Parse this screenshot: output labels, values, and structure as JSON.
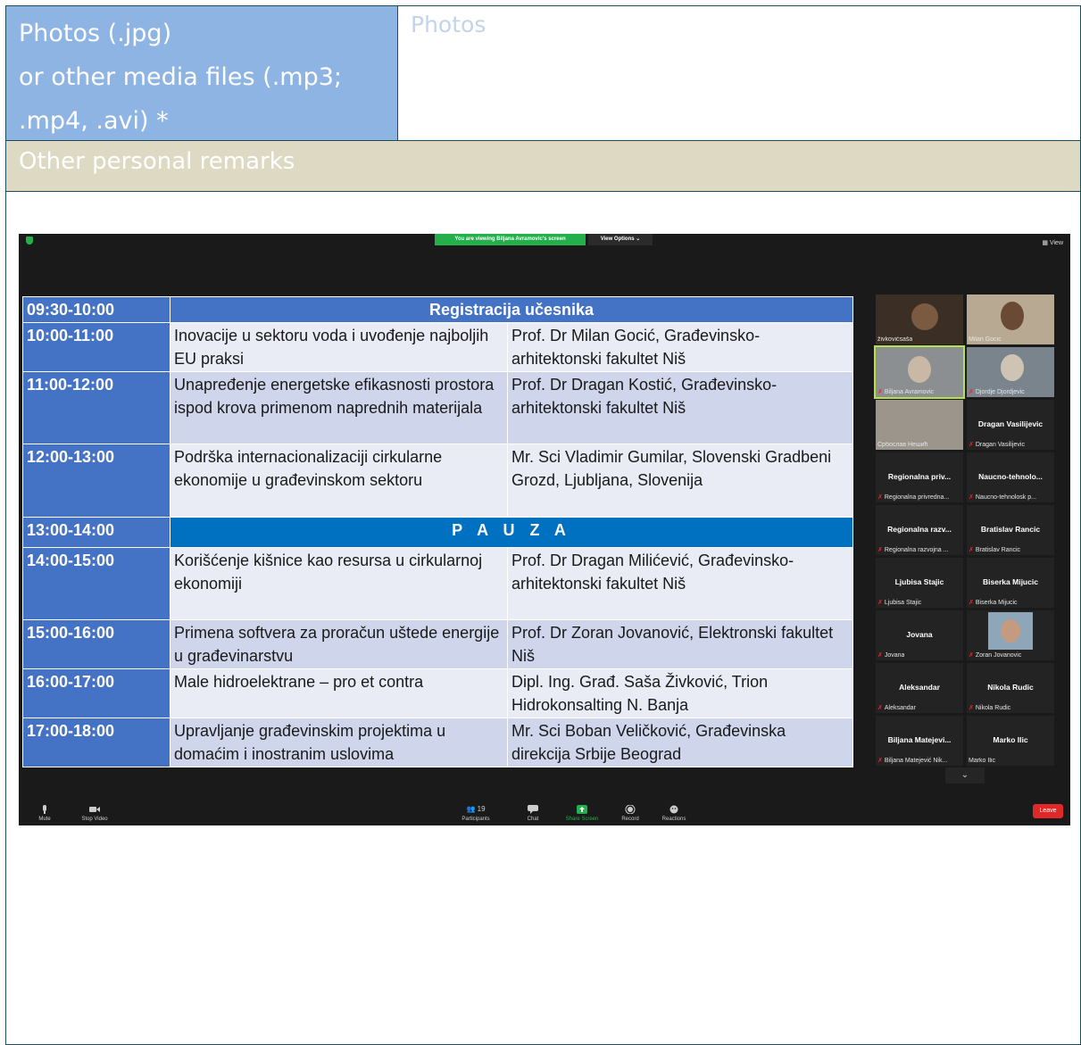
{
  "form": {
    "photos_label_line1": "Photos (.jpg)",
    "photos_label_line2": "or other media files (.mp3;",
    "photos_label_line3": ".mp4, .avi) *",
    "photos_value_placeholder": "Photos",
    "remarks_label": "Other personal remarks"
  },
  "zoom": {
    "viewing_banner": "You are viewing Biljana Avramovic's screen",
    "view_options": "View Options ⌄",
    "view_button": "View",
    "schedule": {
      "header_time": "09:30-10:00",
      "header_title": "Registracija učesnika",
      "pause_time": "13:00-14:00",
      "pause_title": "P A U Z A",
      "rows": [
        {
          "time": "10:00-11:00",
          "topic": "Inovacije u sektoru voda i uvođenje najboljih EU praksi",
          "speaker": "Prof. Dr Milan Gocić, Građevinsko-arhitektonski fakultet Niš"
        },
        {
          "time": "11:00-12:00",
          "topic": "Unapređenje energetske efikasnosti prostora ispod krova primenom naprednih materijala",
          "speaker": "Prof. Dr Dragan Kostić, Građevinsko-arhitektonski fakultet Niš"
        },
        {
          "time": "12:00-13:00",
          "topic": "Podrška internacionalizaciji cirkularne ekonomije u građevinskom sektoru",
          "speaker": "Mr. Sci Vladimir Gumilar, Slovenski Gradbeni Grozd, Ljubljana, Slovenija"
        },
        {
          "time": "14:00-15:00",
          "topic": "Korišćenje kišnice kao resursa u cirkularnoj ekonomiji",
          "speaker": "Prof. Dr Dragan Milićević, Građevinsko-arhitektonski fakultet Niš"
        },
        {
          "time": "15:00-16:00",
          "topic": "Primena softvera za proračun uštede energije u građevinarstvu",
          "speaker": "Prof. Dr Zoran Jovanović, Elektronski fakultet Niš"
        },
        {
          "time": "16:00-17:00",
          "topic": "Male hidroelektrane – pro et contra",
          "speaker": "Dipl. Ing. Građ. Saša Živković, Trion Hidrokonsalting N. Banja"
        },
        {
          "time": "17:00-18:00",
          "topic": "Upravljanje građevinskim projektima u domaćim i inostranim uslovima",
          "speaker": "Mr. Sci Boban Veličković,  Građevinska direkcija Srbije Beograd"
        }
      ]
    },
    "participants": [
      {
        "name": "",
        "label": "živkovićsaša"
      },
      {
        "name": "",
        "label": "Milan Gocic"
      },
      {
        "name": "",
        "label": "Biljana Avramovic"
      },
      {
        "name": "",
        "label": "Djordje Djordjevic"
      },
      {
        "name": "",
        "label": "Србослав Нешић"
      },
      {
        "name": "Dragan Vasilijevic",
        "label": "Dragan Vasilijevic"
      },
      {
        "name": "Regionalna  priv...",
        "label": "Regionalna privredna..."
      },
      {
        "name": "Naucno-tehnolo...",
        "label": "Naucno-tehnolosk p..."
      },
      {
        "name": "Regionalna  razv...",
        "label": "Regionalna razvojna ..."
      },
      {
        "name": "Bratislav Rancic",
        "label": "Bratislav Rancic"
      },
      {
        "name": "Ljubisa Stajic",
        "label": "Ljubisa Stajic"
      },
      {
        "name": "Biserka Mijucic",
        "label": "Biserka Mijucic"
      },
      {
        "name": "Jovana",
        "label": "Jovana"
      },
      {
        "name": "",
        "label": "Zoran Jovanovic"
      },
      {
        "name": "Aleksandar",
        "label": "Aleksandar"
      },
      {
        "name": "Nikola Rudic",
        "label": "Nikola Rudic"
      },
      {
        "name": "Biljana  Matejevi...",
        "label": "Biljana Matejević Nik..."
      },
      {
        "name": "Marko Ilic",
        "label": "Marko Ilic"
      }
    ],
    "controls": {
      "mute": "Mute",
      "stop_video": "Stop Video",
      "participants": "Participants",
      "participants_count": "19",
      "chat": "Chat",
      "share_screen": "Share Screen",
      "record": "Record",
      "reactions": "Reactions",
      "leave": "Leave"
    },
    "colors": {
      "accent_green": "#23b04b",
      "leave_red": "#e02828",
      "header_blue": "#4472c4",
      "pause_blue": "#0070c0"
    }
  }
}
